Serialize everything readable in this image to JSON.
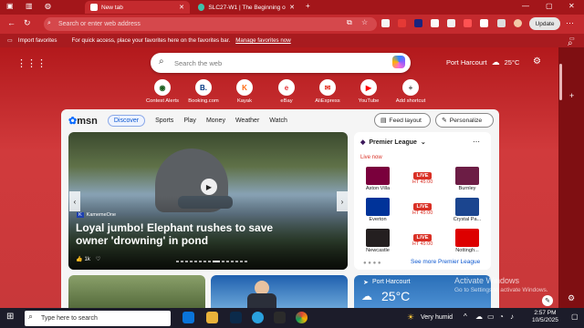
{
  "tabs": [
    {
      "label": "New tab",
      "active": true
    },
    {
      "label": "SLC27-W1 | The Beginning of Bo...",
      "active": false
    }
  ],
  "address": {
    "placeholder": "Search or enter web address"
  },
  "toolbar": {
    "update_label": "Update"
  },
  "favorites": {
    "import_label": "Import favorites",
    "tip": "For quick access, place your favorites here on the favorites bar.",
    "manage_link": "Manage favorites now"
  },
  "search": {
    "placeholder": "Search the web"
  },
  "weather": {
    "location": "Port Harcourt",
    "temp": "25°C"
  },
  "shortcuts": [
    {
      "label": "Contest Alerts",
      "glyph": "◉",
      "color": "#1b5e20"
    },
    {
      "label": "Booking.com",
      "glyph": "B.",
      "color": "#003580"
    },
    {
      "label": "Kayak",
      "glyph": "K",
      "color": "#ff690f"
    },
    {
      "label": "eBay",
      "glyph": "e",
      "color": "#e53238"
    },
    {
      "label": "AliExpress",
      "glyph": "✉",
      "color": "#e43225"
    },
    {
      "label": "YouTube",
      "glyph": "▶",
      "color": "#ff0000"
    },
    {
      "label": "Add shortcut",
      "glyph": "+",
      "color": "#444"
    }
  ],
  "msn": {
    "logo": "msn",
    "nav": [
      "Discover",
      "Sports",
      "Play",
      "Money",
      "Weather",
      "Watch"
    ],
    "feed_layout": "Feed layout",
    "personalize": "Personalize"
  },
  "hero": {
    "source": "KamemeOne",
    "title": "Loyal jumbo! Elephant rushes to save owner 'drowning' in pond",
    "likes": "1k"
  },
  "sports": {
    "league": "Premier League",
    "live_now": "Live now",
    "see_more": "See more Premier League",
    "matches": [
      {
        "home": "Aston Villa",
        "away": "Burnley",
        "status": "LIVE",
        "time": "HT 45:00",
        "home_color": "#7a003c",
        "away_color": "#6c1d45"
      },
      {
        "home": "Everton",
        "away": "Crystal Pa...",
        "status": "LIVE",
        "time": "HT 45:00",
        "home_color": "#003399",
        "away_color": "#1b458f"
      },
      {
        "home": "Newcastle",
        "away": "Nottingh...",
        "status": "LIVE",
        "time": "HT 45:00",
        "home_color": "#241f20",
        "away_color": "#dd0000"
      }
    ]
  },
  "tiles": {
    "weather_location": "Port Harcourt",
    "weather_temp": "25°C"
  },
  "watermark": {
    "title": "Activate Windows",
    "sub": "Go to Settings to activate Windows."
  },
  "taskbar": {
    "search": "Type here to search",
    "weather": "Very humid",
    "time": "2:57 PM",
    "date": "10/5/2025"
  }
}
